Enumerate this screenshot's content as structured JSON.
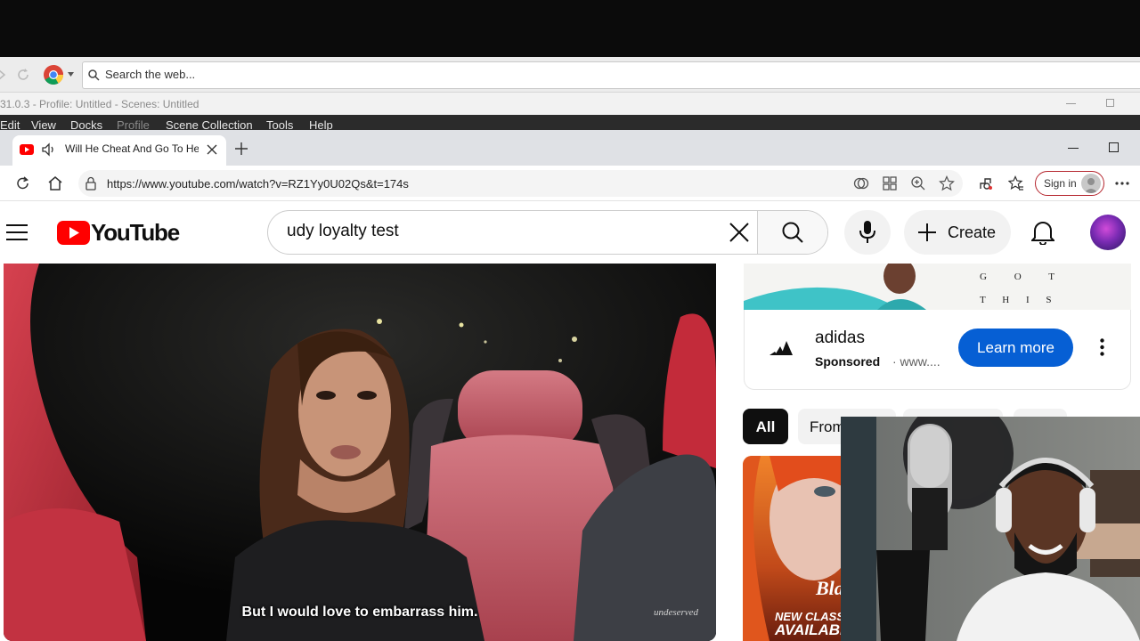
{
  "outer_browser": {
    "search_placeholder": "Search the web..."
  },
  "obs": {
    "title": "31.0.3 - Profile: Untitled - Scenes: Untitled",
    "menu": [
      "Edit",
      "View",
      "Docks",
      "Profile",
      "Scene Collection",
      "Tools",
      "Help"
    ]
  },
  "edge": {
    "tab_title": "Will He Cheat And Go To Hell",
    "url": "https://www.youtube.com/watch?v=RZ1Yy0U02Qs&t=174s",
    "sign_in": "Sign in"
  },
  "youtube": {
    "logo_text": "YouTube",
    "search_value": "udy loyalty test",
    "create_label": "Create",
    "video": {
      "caption": "But I would love to embarrass him."
    },
    "ad": {
      "banner_letters_row1": "G O T",
      "banner_letters_row2": "T H I S",
      "advertiser": "adidas",
      "sponsored": "Sponsored",
      "domain": "· www....",
      "cta": "Learn more"
    },
    "chips": {
      "all": "All",
      "from": "From"
    },
    "thumbnail": {
      "brand": "Bla",
      "text_line1": "NEW CLASS",
      "text_line2": "AVAILABL"
    }
  },
  "colors": {
    "yt_red": "#ff0000",
    "learn_blue": "#065fd4",
    "edge_signin_border": "#b5262e"
  }
}
